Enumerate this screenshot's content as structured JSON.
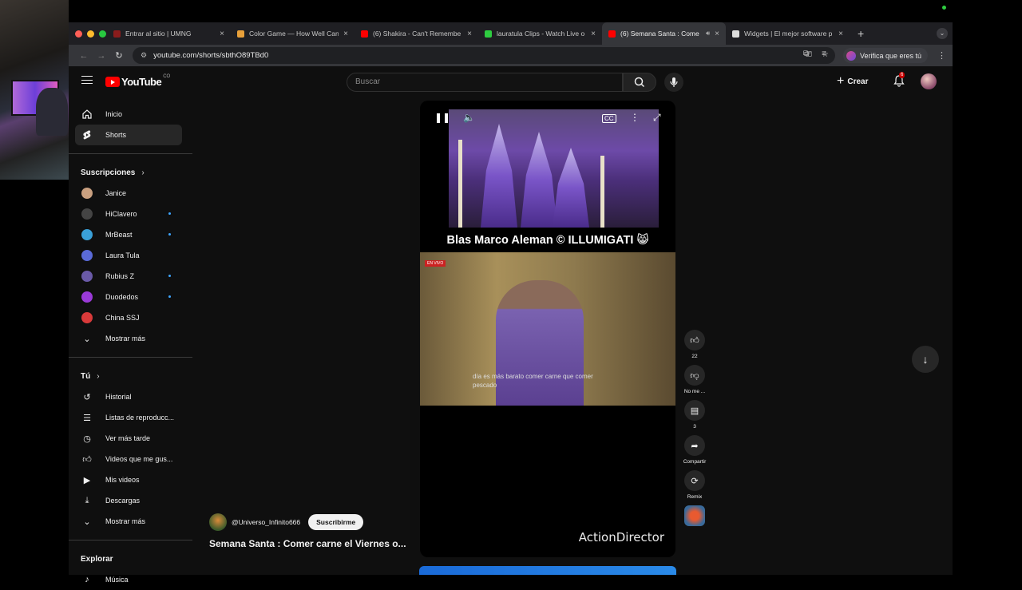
{
  "browser": {
    "tabs": [
      {
        "label": "Entrar al sitio | UMNG",
        "favicon_color": "#8a1c1c",
        "active": false
      },
      {
        "label": "Color Game — How Well Can",
        "favicon_color": "#e8a03a",
        "active": false
      },
      {
        "label": "(6) Shakira - Can't Remembe",
        "favicon_color": "#ff0000",
        "active": false
      },
      {
        "label": "lauratula Clips - Watch Live o",
        "favicon_color": "#2ecc40",
        "active": false
      },
      {
        "label": "(6) Semana Santa : Come",
        "favicon_color": "#ff0000",
        "active": true
      },
      {
        "label": "Widgets | El mejor software p",
        "favicon_color": "#dddddd",
        "active": false
      }
    ],
    "url": "youtube.com/shorts/sbthO89TBd0",
    "verify_label": "Verifica que eres tú"
  },
  "header": {
    "logo_text": "YouTube",
    "country": "CO",
    "search_placeholder": "Buscar",
    "create_label": "Crear",
    "notifications_count": "6"
  },
  "sidebar": {
    "main": [
      {
        "label": "Inicio",
        "icon": "home-icon"
      },
      {
        "label": "Shorts",
        "icon": "shorts-icon",
        "active": true
      }
    ],
    "subscriptions_title": "Suscripciones",
    "subscriptions": [
      {
        "label": "Janice",
        "color": "#c9a080",
        "live": false
      },
      {
        "label": "HiClavero",
        "color": "#444444",
        "live": true
      },
      {
        "label": "MrBeast",
        "color": "#3aa0d8",
        "live": true
      },
      {
        "label": "Laura Tula",
        "color": "#5a6ad8",
        "live": false
      },
      {
        "label": "Rubius Z",
        "color": "#6a5aa8",
        "live": true
      },
      {
        "label": "Duodedos",
        "color": "#9a3ad8",
        "live": true
      },
      {
        "label": "China SSJ",
        "color": "#d83a3a",
        "live": false
      }
    ],
    "show_more_1": "Mostrar más",
    "you_title": "Tú",
    "you_items": [
      {
        "label": "Historial",
        "icon": "history-icon"
      },
      {
        "label": "Listas de reproducc...",
        "icon": "playlists-icon"
      },
      {
        "label": "Ver más tarde",
        "icon": "watch-later-icon"
      },
      {
        "label": "Videos que me gus...",
        "icon": "liked-icon"
      },
      {
        "label": "Mis videos",
        "icon": "my-videos-icon"
      },
      {
        "label": "Descargas",
        "icon": "downloads-icon"
      }
    ],
    "show_more_2": "Mostrar más",
    "explore_title": "Explorar",
    "explore_items": [
      {
        "label": "Música",
        "icon": "music-icon"
      }
    ]
  },
  "short": {
    "caption": "Blas Marco Aleman © ILLUMIGATI 😸",
    "live_tag": "EN VIVO",
    "subtitle_line1": "día es más barato comer carne que comer",
    "subtitle_line2": "pescado",
    "watermark": "ActionDirector",
    "channel": "@Universo_Infinito666",
    "subscribe_label": "Suscribirme",
    "title": "Semana Santa : Comer carne el Viernes o..."
  },
  "actions": {
    "likes": "22",
    "dislike_label": "No me ...",
    "comments": "3",
    "share_label": "Compartir",
    "remix_label": "Remix"
  }
}
